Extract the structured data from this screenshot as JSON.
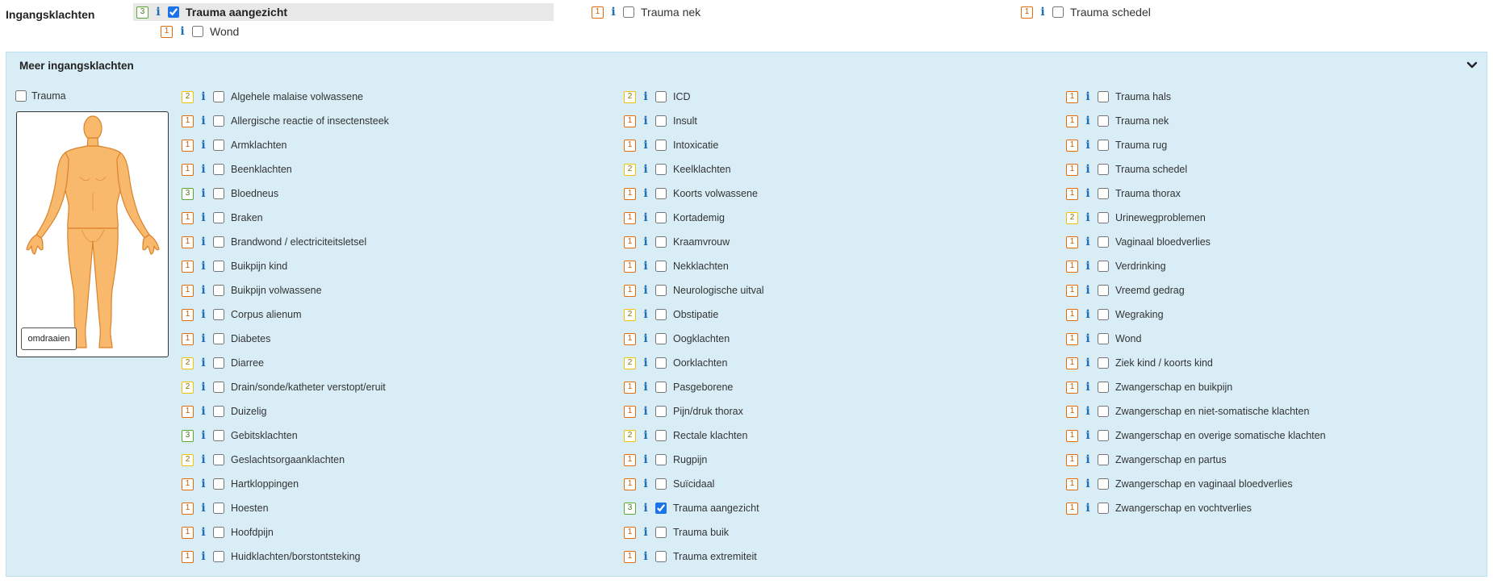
{
  "header": {
    "label": "Ingangsklachten"
  },
  "top_items": [
    {
      "name": "Trauma aangezicht",
      "urgency": "3",
      "checked": true
    },
    {
      "name": "Trauma nek",
      "urgency": "1",
      "checked": false
    },
    {
      "name": "Trauma schedel",
      "urgency": "1",
      "checked": false
    },
    {
      "name": "Wond",
      "urgency": "1",
      "checked": false
    }
  ],
  "panel": {
    "title": "Meer ingangsklachten",
    "trauma_label": "Trauma",
    "flip_button": "omdraaien",
    "info_symbol": "i"
  },
  "columns": [
    [
      {
        "name": "Algehele malaise volwassene",
        "urgency": "2",
        "checked": false
      },
      {
        "name": "Allergische reactie of insectensteek",
        "urgency": "1",
        "checked": false
      },
      {
        "name": "Armklachten",
        "urgency": "1",
        "checked": false
      },
      {
        "name": "Beenklachten",
        "urgency": "1",
        "checked": false
      },
      {
        "name": "Bloedneus",
        "urgency": "3",
        "checked": false
      },
      {
        "name": "Braken",
        "urgency": "1",
        "checked": false
      },
      {
        "name": "Brandwond / electriciteitsletsel",
        "urgency": "1",
        "checked": false
      },
      {
        "name": "Buikpijn kind",
        "urgency": "1",
        "checked": false
      },
      {
        "name": "Buikpijn volwassene",
        "urgency": "1",
        "checked": false
      },
      {
        "name": "Corpus alienum",
        "urgency": "1",
        "checked": false
      },
      {
        "name": "Diabetes",
        "urgency": "1",
        "checked": false
      },
      {
        "name": "Diarree",
        "urgency": "2",
        "checked": false
      },
      {
        "name": "Drain/sonde/katheter verstopt/eruit",
        "urgency": "2",
        "checked": false
      },
      {
        "name": "Duizelig",
        "urgency": "1",
        "checked": false
      },
      {
        "name": "Gebitsklachten",
        "urgency": "3",
        "checked": false
      },
      {
        "name": "Geslachtsorgaanklachten",
        "urgency": "2",
        "checked": false
      },
      {
        "name": "Hartkloppingen",
        "urgency": "1",
        "checked": false
      },
      {
        "name": "Hoesten",
        "urgency": "1",
        "checked": false
      },
      {
        "name": "Hoofdpijn",
        "urgency": "1",
        "checked": false
      },
      {
        "name": "Huidklachten/borstontsteking",
        "urgency": "1",
        "checked": false
      }
    ],
    [
      {
        "name": "ICD",
        "urgency": "2",
        "checked": false
      },
      {
        "name": "Insult",
        "urgency": "1",
        "checked": false
      },
      {
        "name": "Intoxicatie",
        "urgency": "1",
        "checked": false
      },
      {
        "name": "Keelklachten",
        "urgency": "2",
        "checked": false
      },
      {
        "name": "Koorts volwassene",
        "urgency": "1",
        "checked": false
      },
      {
        "name": "Kortademig",
        "urgency": "1",
        "checked": false
      },
      {
        "name": "Kraamvrouw",
        "urgency": "1",
        "checked": false
      },
      {
        "name": "Nekklachten",
        "urgency": "1",
        "checked": false
      },
      {
        "name": "Neurologische uitval",
        "urgency": "1",
        "checked": false
      },
      {
        "name": "Obstipatie",
        "urgency": "2",
        "checked": false
      },
      {
        "name": "Oogklachten",
        "urgency": "1",
        "checked": false
      },
      {
        "name": "Oorklachten",
        "urgency": "2",
        "checked": false
      },
      {
        "name": "Pasgeborene",
        "urgency": "1",
        "checked": false
      },
      {
        "name": "Pijn/druk thorax",
        "urgency": "1",
        "checked": false
      },
      {
        "name": "Rectale klachten",
        "urgency": "2",
        "checked": false
      },
      {
        "name": "Rugpijn",
        "urgency": "1",
        "checked": false
      },
      {
        "name": "Suïcidaal",
        "urgency": "1",
        "checked": false
      },
      {
        "name": "Trauma aangezicht",
        "urgency": "3",
        "checked": true
      },
      {
        "name": "Trauma buik",
        "urgency": "1",
        "checked": false
      },
      {
        "name": "Trauma extremiteit",
        "urgency": "1",
        "checked": false
      }
    ],
    [
      {
        "name": "Trauma hals",
        "urgency": "1",
        "checked": false
      },
      {
        "name": "Trauma nek",
        "urgency": "1",
        "checked": false
      },
      {
        "name": "Trauma rug",
        "urgency": "1",
        "checked": false
      },
      {
        "name": "Trauma schedel",
        "urgency": "1",
        "checked": false
      },
      {
        "name": "Trauma thorax",
        "urgency": "1",
        "checked": false
      },
      {
        "name": "Urinewegproblemen",
        "urgency": "2",
        "checked": false
      },
      {
        "name": "Vaginaal bloedverlies",
        "urgency": "1",
        "checked": false
      },
      {
        "name": "Verdrinking",
        "urgency": "1",
        "checked": false
      },
      {
        "name": "Vreemd gedrag",
        "urgency": "1",
        "checked": false
      },
      {
        "name": "Wegraking",
        "urgency": "1",
        "checked": false
      },
      {
        "name": "Wond",
        "urgency": "1",
        "checked": false
      },
      {
        "name": "Ziek kind / koorts kind",
        "urgency": "1",
        "checked": false
      },
      {
        "name": "Zwangerschap en buikpijn",
        "urgency": "1",
        "checked": false
      },
      {
        "name": "Zwangerschap en niet-somatische klachten",
        "urgency": "1",
        "checked": false
      },
      {
        "name": "Zwangerschap en overige somatische klachten",
        "urgency": "1",
        "checked": false
      },
      {
        "name": "Zwangerschap en partus",
        "urgency": "1",
        "checked": false
      },
      {
        "name": "Zwangerschap en vaginaal bloedverlies",
        "urgency": "1",
        "checked": false
      },
      {
        "name": "Zwangerschap en vochtverlies",
        "urgency": "1",
        "checked": false
      }
    ]
  ],
  "colors": {
    "panel_bg": "#d9edf7",
    "urgency_1": "#e36c0a",
    "urgency_2": "#f2c200",
    "urgency_3": "#5aa832",
    "info": "#1f6fb5",
    "selected_bg": "#e8e8e8",
    "body_fill": "#f9b96c"
  }
}
